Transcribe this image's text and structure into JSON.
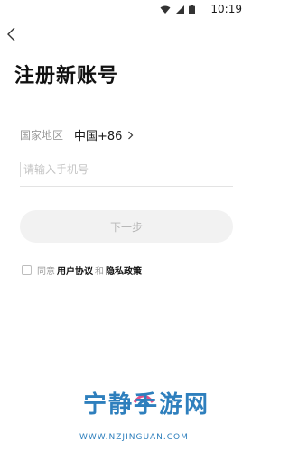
{
  "status_bar": {
    "time": "10:19"
  },
  "header": {
    "title": "注册新账号"
  },
  "region": {
    "label": "国家地区",
    "value": "中国+86"
  },
  "phone": {
    "placeholder": "请输入手机号",
    "value": ""
  },
  "next_button": {
    "label": "下一步"
  },
  "agreement": {
    "prefix": "同意",
    "user_agreement": "用户协议",
    "and": "和",
    "privacy_policy": "隐私政策"
  },
  "watermark": {
    "brand": "宁静手游网",
    "url": "WWW.NZJINGUAN.COM"
  },
  "colors": {
    "accent_watermark": "#2e7fbd",
    "button_bg": "#f2f2f2",
    "button_text": "#b7b7b7"
  }
}
